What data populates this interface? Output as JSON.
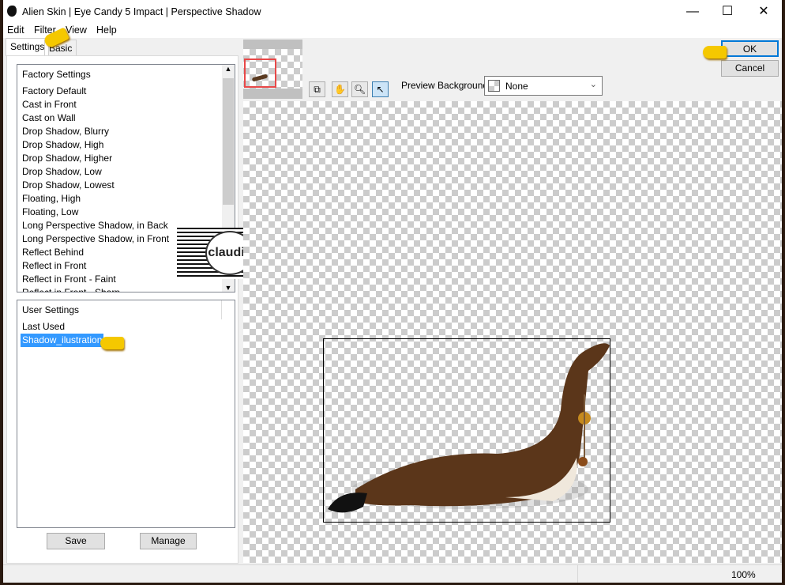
{
  "window": {
    "title": "Alien Skin | Eye Candy 5 Impact | Perspective Shadow",
    "min": "—",
    "max": "☐",
    "close": "✕"
  },
  "menu": [
    "Edit",
    "Filter",
    "View",
    "Help"
  ],
  "tabs": [
    "Settings",
    "Basic"
  ],
  "factory": {
    "header": "Factory Settings",
    "items": [
      "Factory Default",
      "Cast in Front",
      "Cast on Wall",
      "Drop Shadow, Blurry",
      "Drop Shadow, High",
      "Drop Shadow, Higher",
      "Drop Shadow, Low",
      "Drop Shadow, Lowest",
      "Floating, High",
      "Floating, Low",
      "Long Perspective Shadow, in Back",
      "Long Perspective Shadow, in Front",
      "Reflect Behind",
      "Reflect in Front",
      "Reflect in Front - Faint",
      "Reflect in Front - Sharp"
    ]
  },
  "user": {
    "header": "User Settings",
    "items": [
      "Last Used",
      "Shadow_ilustration"
    ],
    "selected": "Shadow_ilustration"
  },
  "buttons": {
    "save": "Save",
    "manage": "Manage",
    "ok": "OK",
    "cancel": "Cancel"
  },
  "preview": {
    "label": "Preview Background:",
    "value": "None"
  },
  "status": {
    "zoom": "100%"
  },
  "watermark": "claudia",
  "colors": {
    "selection": "#3399ff",
    "ok_border": "#0078d7",
    "thumb_frame": "#e84848"
  }
}
